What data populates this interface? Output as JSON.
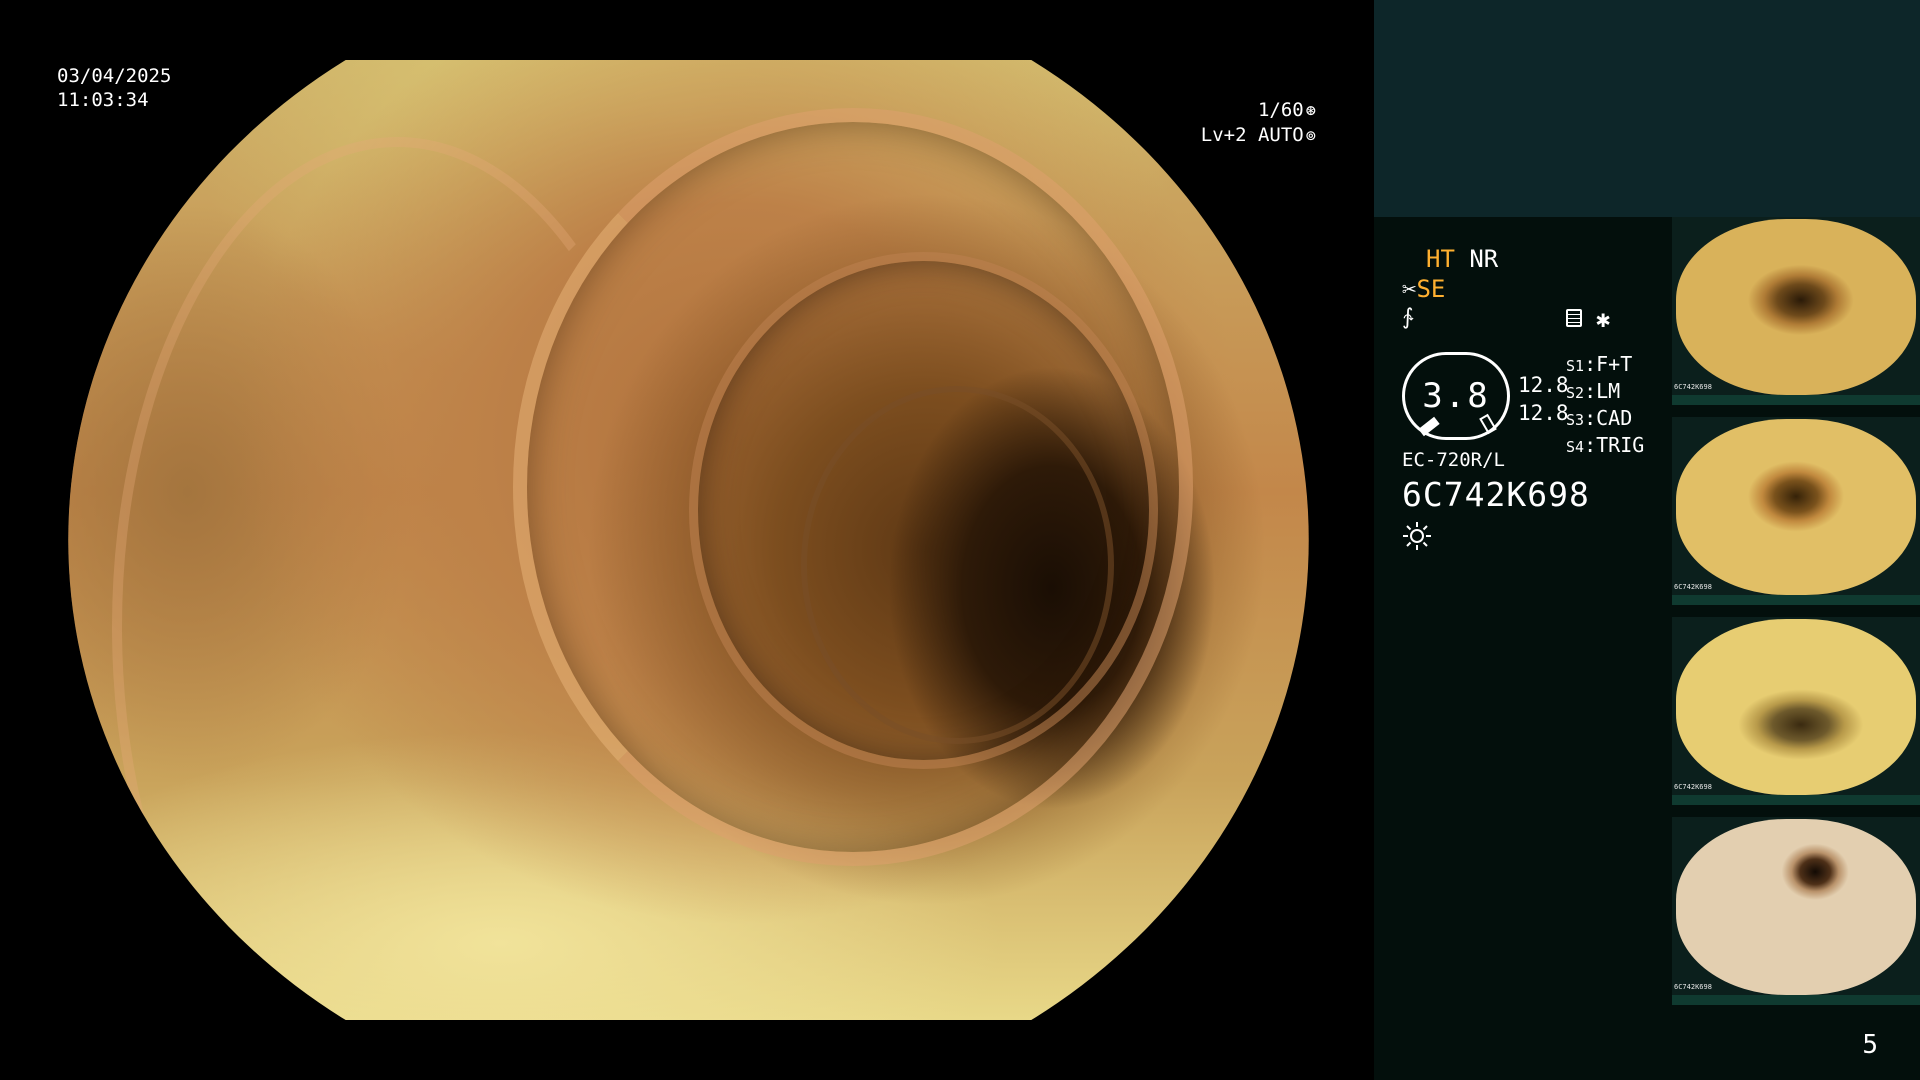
{
  "overlay": {
    "date": "03/04/2025",
    "time": "11:03:34",
    "shutter": "1/60",
    "shutter_icon": "shutter-icon",
    "iris": "Lv+2 AUTO",
    "iris_icon": "iris-icon"
  },
  "processor": {
    "ht_label": "HT",
    "nr_label": "NR",
    "se_label": "SE",
    "gauge_value": "3.8",
    "gauge_nums": [
      "12.8",
      "12.8"
    ],
    "slots": [
      {
        "key": "S1",
        "value": "F+T"
      },
      {
        "key": "S2",
        "value": "LM"
      },
      {
        "key": "S3",
        "value": "CAD"
      },
      {
        "key": "S4",
        "value": "TRIG"
      }
    ],
    "scope_model": "EC-720R/L",
    "scope_serial": "6C742K698",
    "icons": [
      "scissors-icon",
      "wave-icon",
      "menu-icon",
      "asterisk-icon",
      "light-icon"
    ]
  },
  "thumbnails": [
    {
      "serial": "6C742K698"
    },
    {
      "serial": "6C742K698"
    },
    {
      "serial": "6C742K698"
    },
    {
      "serial": "6C742K698"
    }
  ],
  "page_number": "5",
  "colors": {
    "accent": "#ffb030",
    "side_top": "#0d2629",
    "side_panel": "#030f0c"
  }
}
